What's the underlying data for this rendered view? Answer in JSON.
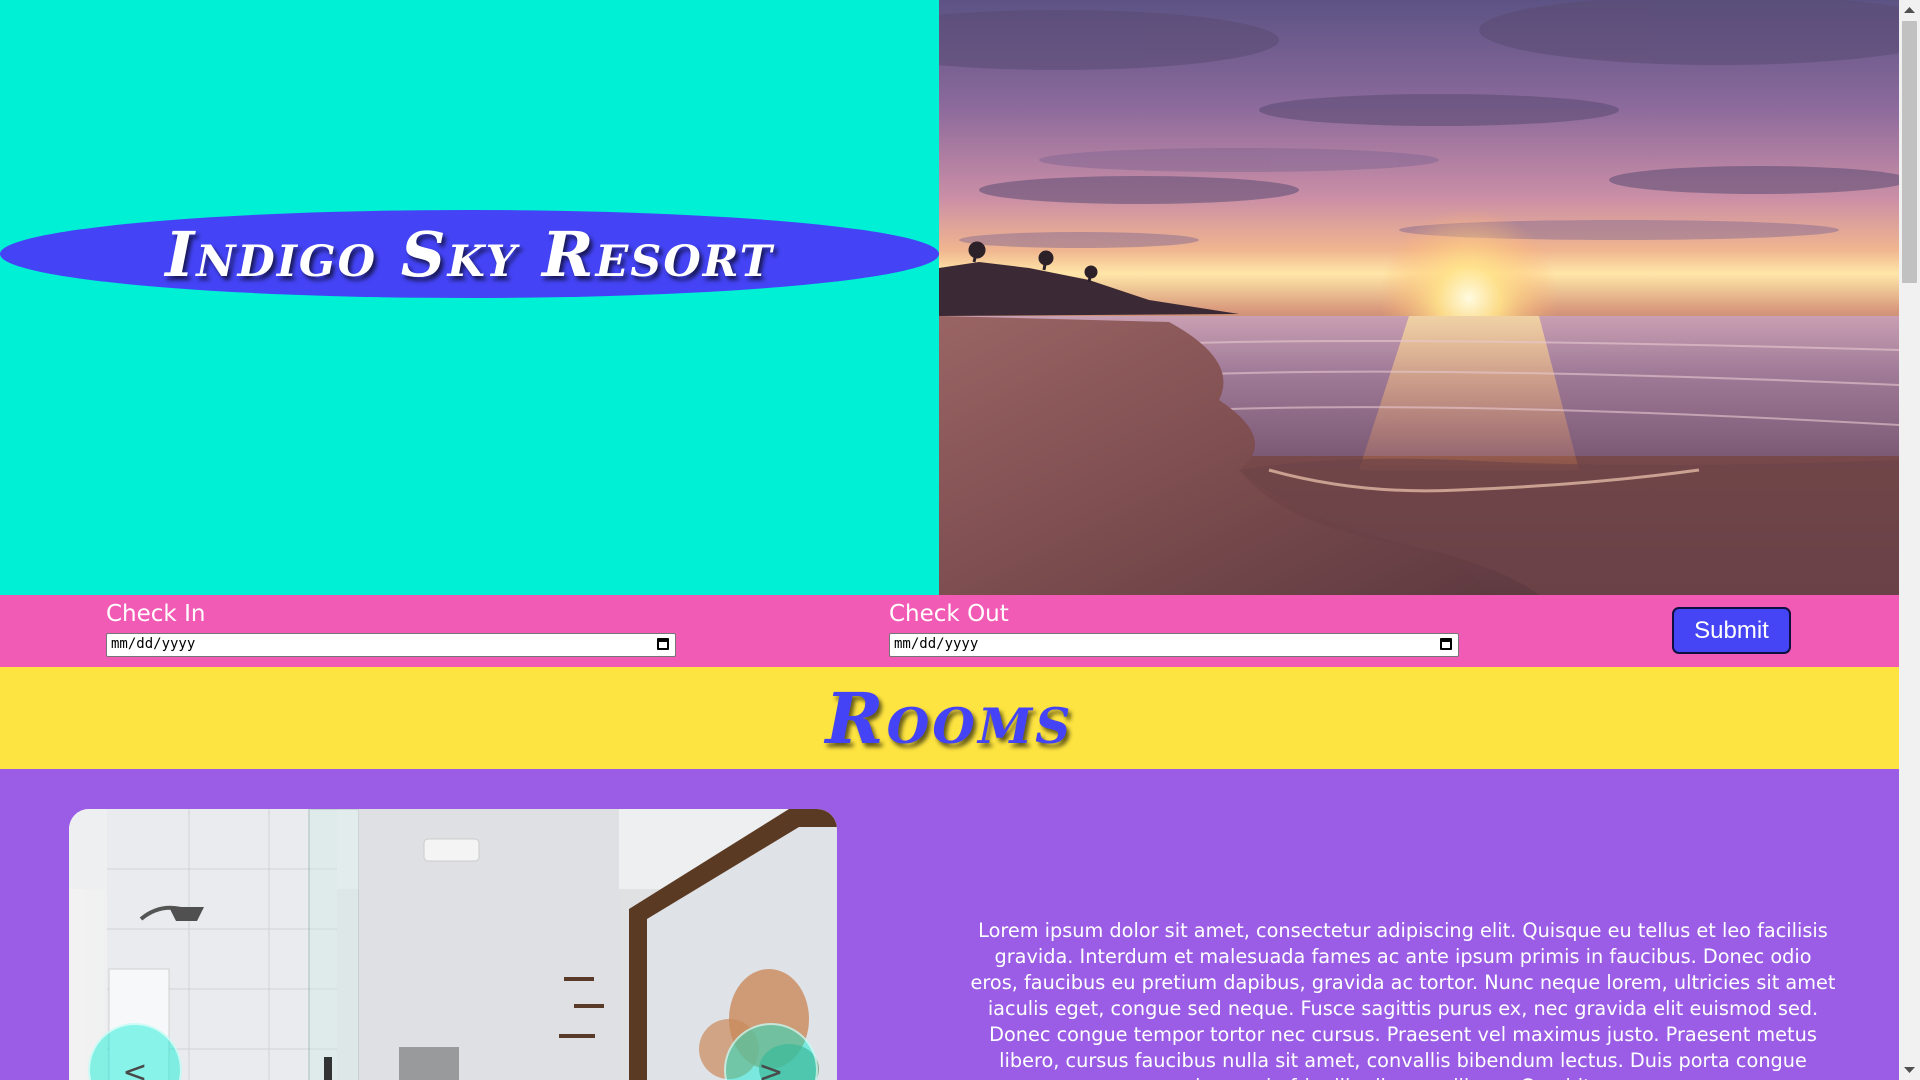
{
  "hero": {
    "title": "Indigo Sky Resort",
    "image_alt": "Sunset over beach"
  },
  "booking": {
    "check_in_label": "Check In",
    "check_in_placeholder": "mm/dd/yyyy",
    "check_out_label": "Check Out",
    "check_out_placeholder": "mm/dd/yyyy",
    "submit_label": "Submit"
  },
  "rooms": {
    "heading": "Rooms",
    "prev_label": "<",
    "next_label": ">",
    "description": "Lorem ipsum dolor sit amet, consectetur adipiscing elit. Quisque eu tellus et leo facilisis gravida. Interdum et malesuada fames ac ante ipsum primis in faucibus. Donec odio eros, faucibus eu pretium dapibus, gravida ac tortor. Nunc neque lorem, ultricies sit amet iaculis eget, congue sed neque. Fusce sagittis purus ex, nec gravida elit euismod sed. Donec congue tempor tortor nec cursus. Praesent vel maximus justo. Praesent metus libero, cursus faucibus nulla sit amet, convallis bibendum lectus. Duis porta congue ipsum, in fringilla diam mollis ac. Curabitur"
  },
  "colors": {
    "teal": "#00f0d5",
    "indigo": "#4444f6",
    "pink": "#f15bb5",
    "yellow": "#fee440",
    "purple": "#9b5de5"
  }
}
